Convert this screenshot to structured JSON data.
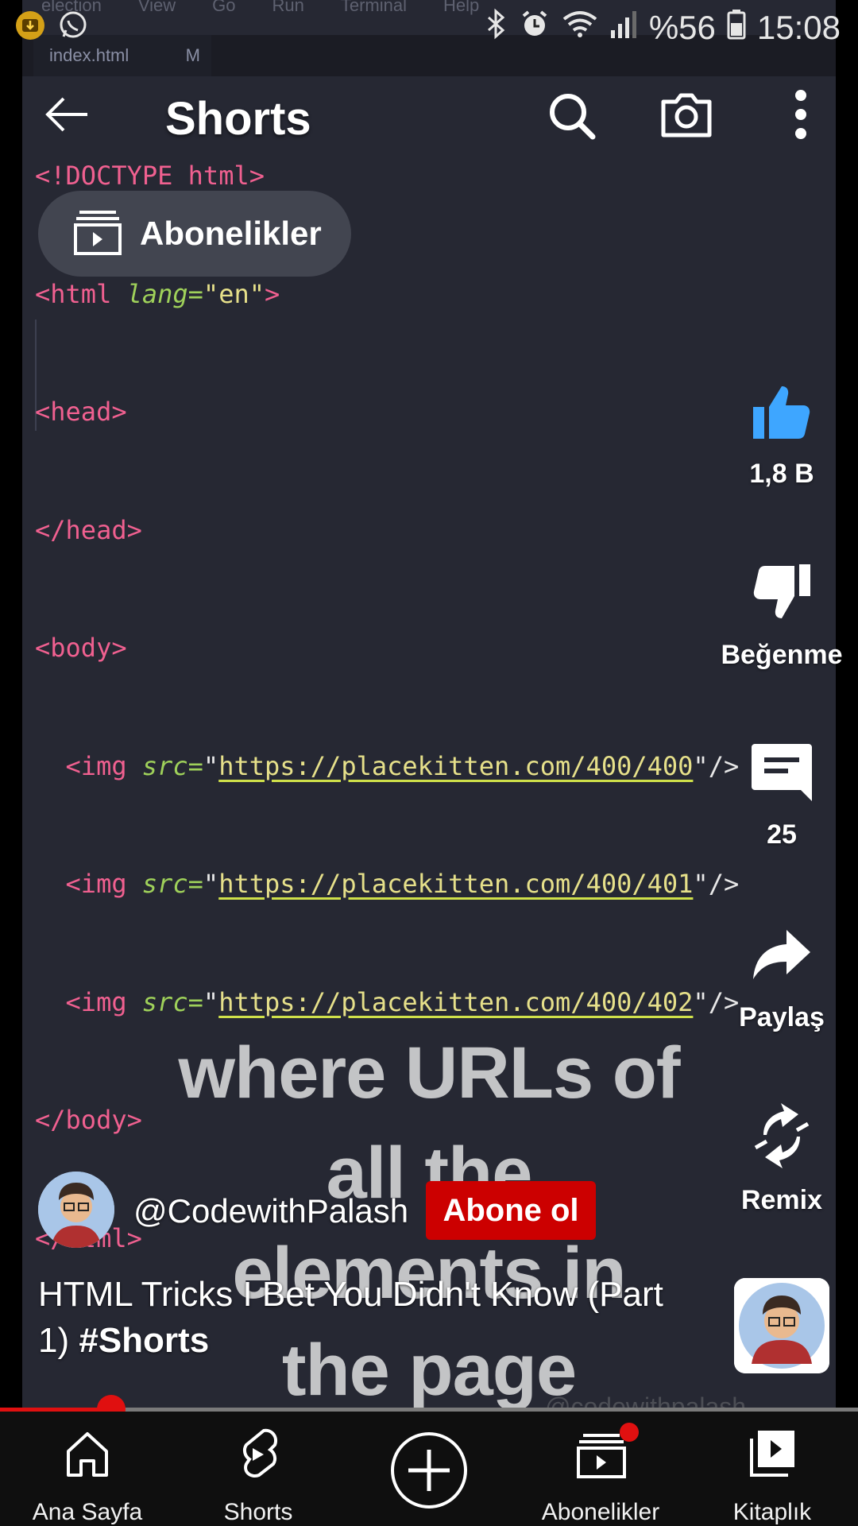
{
  "status_bar": {
    "battery": "%56",
    "time": "15:08"
  },
  "video_editor": {
    "menu": [
      "election",
      "View",
      "Go",
      "Run",
      "Terminal",
      "Help"
    ],
    "tab": {
      "filename": "index.html",
      "status": "M"
    },
    "code": {
      "doctype": "<!DOCTYPE html>",
      "html_open_tag": "<html",
      "html_lang_attr": "lang=",
      "html_lang_val": "\"en\"",
      "head_open": "<head>",
      "head_close": "</head>",
      "body_open": "<body>",
      "img_tag": "<img",
      "src_attr": "src=",
      "urls": [
        "https://placekitten.com/400/400",
        "https://placekitten.com/400/401",
        "https://placekitten.com/400/402"
      ],
      "close_self": "\"/>",
      "body_close": "</body>",
      "html_close": "</html>"
    }
  },
  "overlay_caption": [
    "where URLs of",
    "all the",
    "elements in",
    "the page"
  ],
  "watermark": "@codewithpalash",
  "header": {
    "title": "Shorts"
  },
  "chip": {
    "label": "Abonelikler"
  },
  "actions": {
    "like": "1,8 B",
    "dislike": "Beğenme",
    "comments": "25",
    "share": "Paylaş",
    "remix": "Remix"
  },
  "channel": {
    "name": "@CodewithPalash",
    "subscribe_label": "Abone ol"
  },
  "video_title": {
    "text": "HTML Tricks I Bet You Didn't Know (Part 1)",
    "hashtag": "#Shorts"
  },
  "progress": {
    "fraction": 0.13
  },
  "bottom_nav": {
    "home": "Ana Sayfa",
    "shorts": "Shorts",
    "subscriptions": "Abonelikler",
    "library": "Kitaplık"
  },
  "colors": {
    "accent_red": "#cc0000",
    "like_blue": "#3ea6ff",
    "bg": "#262833"
  }
}
